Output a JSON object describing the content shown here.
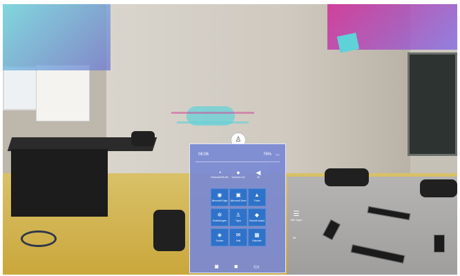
{
  "start_menu": {
    "time": "06:06",
    "battery": "76%",
    "quick_actions": [
      {
        "icon": "wifi-icon",
        "label": "EduroamWLAN"
      },
      {
        "icon": "microphone-icon",
        "label": "Sprache ein"
      },
      {
        "icon": "speaker-icon",
        "label": "40"
      }
    ],
    "tiles": [
      {
        "icon": "edge-icon",
        "label": "Microsoft Edge"
      },
      {
        "icon": "store-icon",
        "label": "Microsoft Store"
      },
      {
        "icon": "photos-icon",
        "label": "Fotos"
      },
      {
        "icon": "gear-icon",
        "label": "Einstellungen"
      },
      {
        "icon": "tips-icon",
        "label": "Tipps"
      },
      {
        "icon": "remote-assist-icon",
        "label": "Remote Assist"
      },
      {
        "icon": "guides-icon",
        "label": "Guides"
      },
      {
        "icon": "mail-icon",
        "label": "Mail"
      },
      {
        "icon": "calendar-icon",
        "label": "Kalender"
      }
    ],
    "all_apps_label": "Alle Apps",
    "bottom_actions": [
      "camera-icon",
      "video-icon",
      "cast-icon"
    ]
  },
  "colors": {
    "panel": "#7a89d3",
    "tile": "#2f72c9",
    "hologram_cyan": "#5fd1d8",
    "hologram_magenta": "#d22a8c"
  }
}
